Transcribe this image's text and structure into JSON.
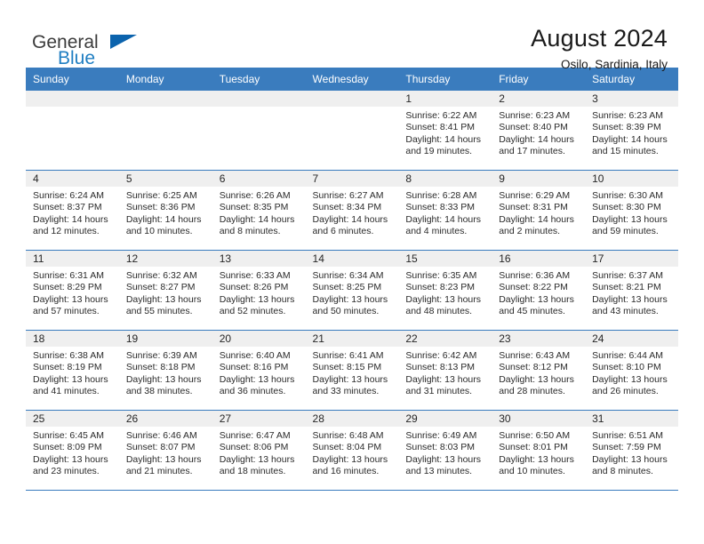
{
  "brand": {
    "name_part1": "General",
    "name_part2": "Blue",
    "flag_icon": "triangle-flag-icon"
  },
  "header": {
    "title": "August 2024",
    "location": "Osilo, Sardinia, Italy"
  },
  "colors": {
    "header_blue": "#3a7cbe",
    "brand_blue": "#1f7ec2",
    "flag_blue": "#0b63ad",
    "daynum_bg": "#efefef",
    "text": "#262626"
  },
  "calendar": {
    "weekday_headers": [
      "Sunday",
      "Monday",
      "Tuesday",
      "Wednesday",
      "Thursday",
      "Friday",
      "Saturday"
    ],
    "weeks": [
      [
        {
          "day": "",
          "lines": []
        },
        {
          "day": "",
          "lines": []
        },
        {
          "day": "",
          "lines": []
        },
        {
          "day": "",
          "lines": []
        },
        {
          "day": "1",
          "lines": [
            "Sunrise: 6:22 AM",
            "Sunset: 8:41 PM",
            "Daylight: 14 hours",
            "and 19 minutes."
          ]
        },
        {
          "day": "2",
          "lines": [
            "Sunrise: 6:23 AM",
            "Sunset: 8:40 PM",
            "Daylight: 14 hours",
            "and 17 minutes."
          ]
        },
        {
          "day": "3",
          "lines": [
            "Sunrise: 6:23 AM",
            "Sunset: 8:39 PM",
            "Daylight: 14 hours",
            "and 15 minutes."
          ]
        }
      ],
      [
        {
          "day": "4",
          "lines": [
            "Sunrise: 6:24 AM",
            "Sunset: 8:37 PM",
            "Daylight: 14 hours",
            "and 12 minutes."
          ]
        },
        {
          "day": "5",
          "lines": [
            "Sunrise: 6:25 AM",
            "Sunset: 8:36 PM",
            "Daylight: 14 hours",
            "and 10 minutes."
          ]
        },
        {
          "day": "6",
          "lines": [
            "Sunrise: 6:26 AM",
            "Sunset: 8:35 PM",
            "Daylight: 14 hours",
            "and 8 minutes."
          ]
        },
        {
          "day": "7",
          "lines": [
            "Sunrise: 6:27 AM",
            "Sunset: 8:34 PM",
            "Daylight: 14 hours",
            "and 6 minutes."
          ]
        },
        {
          "day": "8",
          "lines": [
            "Sunrise: 6:28 AM",
            "Sunset: 8:33 PM",
            "Daylight: 14 hours",
            "and 4 minutes."
          ]
        },
        {
          "day": "9",
          "lines": [
            "Sunrise: 6:29 AM",
            "Sunset: 8:31 PM",
            "Daylight: 14 hours",
            "and 2 minutes."
          ]
        },
        {
          "day": "10",
          "lines": [
            "Sunrise: 6:30 AM",
            "Sunset: 8:30 PM",
            "Daylight: 13 hours",
            "and 59 minutes."
          ]
        }
      ],
      [
        {
          "day": "11",
          "lines": [
            "Sunrise: 6:31 AM",
            "Sunset: 8:29 PM",
            "Daylight: 13 hours",
            "and 57 minutes."
          ]
        },
        {
          "day": "12",
          "lines": [
            "Sunrise: 6:32 AM",
            "Sunset: 8:27 PM",
            "Daylight: 13 hours",
            "and 55 minutes."
          ]
        },
        {
          "day": "13",
          "lines": [
            "Sunrise: 6:33 AM",
            "Sunset: 8:26 PM",
            "Daylight: 13 hours",
            "and 52 minutes."
          ]
        },
        {
          "day": "14",
          "lines": [
            "Sunrise: 6:34 AM",
            "Sunset: 8:25 PM",
            "Daylight: 13 hours",
            "and 50 minutes."
          ]
        },
        {
          "day": "15",
          "lines": [
            "Sunrise: 6:35 AM",
            "Sunset: 8:23 PM",
            "Daylight: 13 hours",
            "and 48 minutes."
          ]
        },
        {
          "day": "16",
          "lines": [
            "Sunrise: 6:36 AM",
            "Sunset: 8:22 PM",
            "Daylight: 13 hours",
            "and 45 minutes."
          ]
        },
        {
          "day": "17",
          "lines": [
            "Sunrise: 6:37 AM",
            "Sunset: 8:21 PM",
            "Daylight: 13 hours",
            "and 43 minutes."
          ]
        }
      ],
      [
        {
          "day": "18",
          "lines": [
            "Sunrise: 6:38 AM",
            "Sunset: 8:19 PM",
            "Daylight: 13 hours",
            "and 41 minutes."
          ]
        },
        {
          "day": "19",
          "lines": [
            "Sunrise: 6:39 AM",
            "Sunset: 8:18 PM",
            "Daylight: 13 hours",
            "and 38 minutes."
          ]
        },
        {
          "day": "20",
          "lines": [
            "Sunrise: 6:40 AM",
            "Sunset: 8:16 PM",
            "Daylight: 13 hours",
            "and 36 minutes."
          ]
        },
        {
          "day": "21",
          "lines": [
            "Sunrise: 6:41 AM",
            "Sunset: 8:15 PM",
            "Daylight: 13 hours",
            "and 33 minutes."
          ]
        },
        {
          "day": "22",
          "lines": [
            "Sunrise: 6:42 AM",
            "Sunset: 8:13 PM",
            "Daylight: 13 hours",
            "and 31 minutes."
          ]
        },
        {
          "day": "23",
          "lines": [
            "Sunrise: 6:43 AM",
            "Sunset: 8:12 PM",
            "Daylight: 13 hours",
            "and 28 minutes."
          ]
        },
        {
          "day": "24",
          "lines": [
            "Sunrise: 6:44 AM",
            "Sunset: 8:10 PM",
            "Daylight: 13 hours",
            "and 26 minutes."
          ]
        }
      ],
      [
        {
          "day": "25",
          "lines": [
            "Sunrise: 6:45 AM",
            "Sunset: 8:09 PM",
            "Daylight: 13 hours",
            "and 23 minutes."
          ]
        },
        {
          "day": "26",
          "lines": [
            "Sunrise: 6:46 AM",
            "Sunset: 8:07 PM",
            "Daylight: 13 hours",
            "and 21 minutes."
          ]
        },
        {
          "day": "27",
          "lines": [
            "Sunrise: 6:47 AM",
            "Sunset: 8:06 PM",
            "Daylight: 13 hours",
            "and 18 minutes."
          ]
        },
        {
          "day": "28",
          "lines": [
            "Sunrise: 6:48 AM",
            "Sunset: 8:04 PM",
            "Daylight: 13 hours",
            "and 16 minutes."
          ]
        },
        {
          "day": "29",
          "lines": [
            "Sunrise: 6:49 AM",
            "Sunset: 8:03 PM",
            "Daylight: 13 hours",
            "and 13 minutes."
          ]
        },
        {
          "day": "30",
          "lines": [
            "Sunrise: 6:50 AM",
            "Sunset: 8:01 PM",
            "Daylight: 13 hours",
            "and 10 minutes."
          ]
        },
        {
          "day": "31",
          "lines": [
            "Sunrise: 6:51 AM",
            "Sunset: 7:59 PM",
            "Daylight: 13 hours",
            "and 8 minutes."
          ]
        }
      ]
    ]
  }
}
